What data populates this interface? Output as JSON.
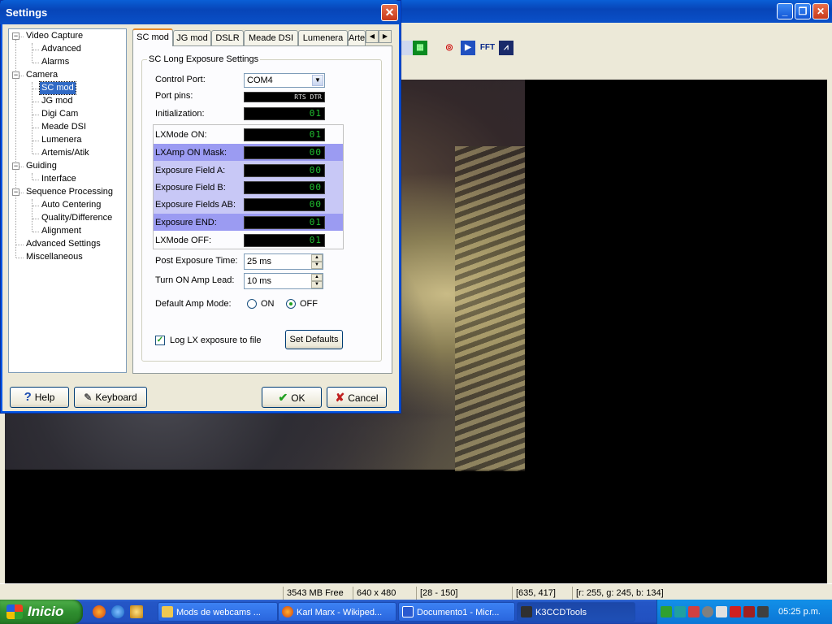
{
  "main_window": {
    "minimize_glyph": "_",
    "maximize_glyph": "❐",
    "close_glyph": "✕",
    "toolbar_icons": [
      "ccd-icon",
      "scope-icon",
      "fft-icon",
      "chart-icon"
    ],
    "toolbar_fft_label": "FFT"
  },
  "status": {
    "free_space": "3543 MB Free",
    "resolution": "640 x 480",
    "range": "[28 - 150]",
    "cursor": "[635, 417]",
    "color": "[r: 255, g: 245, b: 134]"
  },
  "taskbar": {
    "start_label": "Inicio",
    "items": [
      {
        "label": "Mods de webcams ..."
      },
      {
        "label": "Karl Marx - Wikiped..."
      },
      {
        "label": "Documento1 - Micr..."
      },
      {
        "label": "K3CCDTools"
      }
    ],
    "clock": "05:25 p.m."
  },
  "dialog": {
    "title": "Settings",
    "close_glyph": "✕",
    "tree": [
      {
        "label": "Video Capture",
        "level": 0,
        "expander": "−"
      },
      {
        "label": "Advanced",
        "level": 1
      },
      {
        "label": "Alarms",
        "level": 1
      },
      {
        "label": "Camera",
        "level": 0,
        "expander": "−"
      },
      {
        "label": "SC mod",
        "level": 1,
        "selected": true
      },
      {
        "label": "JG mod",
        "level": 1
      },
      {
        "label": "Digi Cam",
        "level": 1
      },
      {
        "label": "Meade DSI",
        "level": 1
      },
      {
        "label": "Lumenera",
        "level": 1
      },
      {
        "label": "Artemis/Atik",
        "level": 1
      },
      {
        "label": "Guiding",
        "level": 0,
        "expander": "−"
      },
      {
        "label": "Interface",
        "level": 1
      },
      {
        "label": "Sequence Processing",
        "level": 0,
        "expander": "−"
      },
      {
        "label": "Auto Centering",
        "level": 1
      },
      {
        "label": "Quality/Difference",
        "level": 1
      },
      {
        "label": "Alignment",
        "level": 1
      },
      {
        "label": "Advanced Settings",
        "level": 0
      },
      {
        "label": "Miscellaneous",
        "level": 0
      }
    ],
    "tabs": [
      "SC mod",
      "JG mod",
      "DSLR",
      "Meade DSI",
      "Lumenera",
      "Arte"
    ],
    "tab_scroll_left": "◀",
    "tab_scroll_right": "▶",
    "group_title": "SC Long Exposure Settings",
    "control_port": {
      "label": "Control Port:",
      "value": "COM4",
      "arrow": "▼"
    },
    "port_pins": {
      "label": "Port pins:",
      "value": "RTS DTR"
    },
    "initialization": {
      "label": "Initialization:",
      "value": "01"
    },
    "lx_rows": [
      {
        "label": "LXMode ON:",
        "value": "01"
      },
      {
        "label": "LXAmp ON Mask:",
        "value": "00"
      },
      {
        "label": "Exposure Field A:",
        "value": "00"
      },
      {
        "label": "Exposure Field B:",
        "value": "00"
      },
      {
        "label": "Exposure Fields AB:",
        "value": "00"
      },
      {
        "label": "Exposure END:",
        "value": "01"
      },
      {
        "label": "LXMode OFF:",
        "value": "01"
      }
    ],
    "post_exposure": {
      "label": "Post Exposure Time:",
      "value": "25 ms"
    },
    "amp_lead": {
      "label": "Turn ON Amp Lead:",
      "value": "10 ms"
    },
    "spin_up": "▲",
    "spin_down": "▼",
    "default_amp": {
      "label": "Default Amp Mode:",
      "on_label": "ON",
      "off_label": "OFF",
      "selected": "OFF"
    },
    "log_checkbox": {
      "label": "Log LX exposure to file",
      "checked": true,
      "mark": "✓"
    },
    "set_defaults_label": "Set Defaults",
    "help_label": "Help",
    "help_glyph": "?",
    "keyboard_label": "Keyboard",
    "keyboard_glyph": "✎",
    "ok_label": "OK",
    "ok_glyph": "✔",
    "cancel_label": "Cancel",
    "cancel_glyph": "✘"
  }
}
